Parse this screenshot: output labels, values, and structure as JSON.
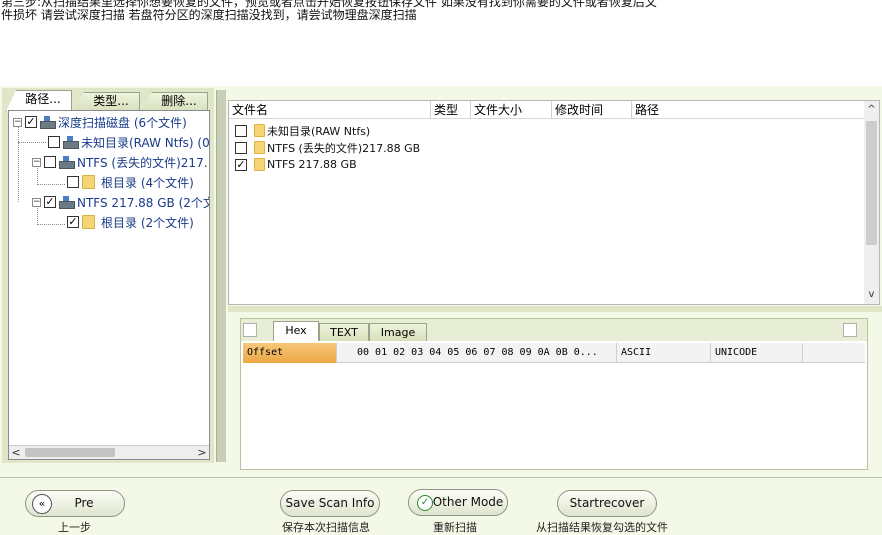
{
  "instructions": {
    "line1": "第三步:从扫描结果里选择你想要恢复的文件，预览或者点击开始恢复按钮保存文件 如果没有找到你需要的文件或者恢复后文",
    "line2": "件损坏 请尝试深度扫描 若盘符分区的深度扫描没找到，请尝试物理盘深度扫描"
  },
  "left_tabs": [
    "路径...",
    "类型...",
    "删除..."
  ],
  "tree": {
    "root": {
      "label": "深度扫描磁盘 (6个文件)",
      "checked": true
    },
    "items": [
      {
        "label": "未知目录(RAW Ntfs) (0",
        "checked": false
      },
      {
        "label": "NTFS (丢失的文件)217.",
        "checked": false
      },
      {
        "label": "根目录 (4个文件)",
        "checked": false
      },
      {
        "label": "NTFS 217.88 GB (2个文",
        "checked": true
      },
      {
        "label": "根目录 (2个文件)",
        "checked": true
      }
    ],
    "scroll_left": "<",
    "scroll_right": ">"
  },
  "file_list": {
    "columns": [
      "文件名",
      "类型",
      "文件大小",
      "修改时间",
      "路径"
    ],
    "rows": [
      {
        "name": "未知目录(RAW Ntfs)",
        "checked": false
      },
      {
        "name": "NTFS (丢失的文件)217.88 GB",
        "checked": false
      },
      {
        "name": "NTFS 217.88 GB",
        "checked": true
      }
    ],
    "scroll_up": "^",
    "scroll_down": "v"
  },
  "hex_viewer": {
    "tabs": [
      "Hex",
      "TEXT",
      "Image"
    ],
    "header": {
      "offset": "Offset",
      "bytes": "00 01 02 03 04 05 06 07   08 09 0A 0B 0...",
      "ascii": "ASCII",
      "unicode": "UNICODE"
    }
  },
  "buttons": {
    "pre": "Pre",
    "pre_icon": "«",
    "save_scan": "Save Scan Info",
    "other_mode": "Other Mode",
    "other_mode_icon": "✓",
    "start_recover": "Startrecover"
  },
  "captions": {
    "pre": "上一步",
    "save_scan": "保存本次扫描信息",
    "other_mode": "重新扫描",
    "start_recover": "从扫描结果恢复勾选的文件"
  }
}
